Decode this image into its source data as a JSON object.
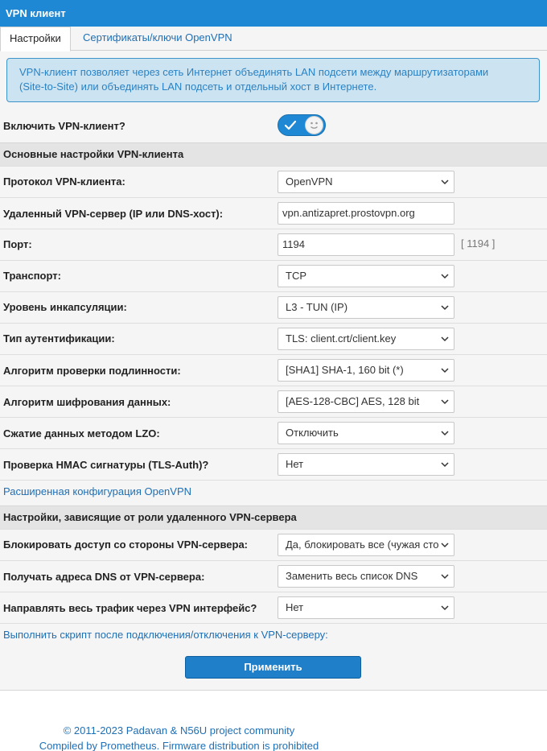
{
  "window": {
    "title": "VPN клиент"
  },
  "tabs": [
    {
      "label": "Настройки",
      "active": true
    },
    {
      "label": "Сертификаты/ключи OpenVPN",
      "active": false
    }
  ],
  "info": {
    "line1": "VPN-клиент позволяет через сеть Интернет объединять LAN подсети между маршрутизаторами",
    "line2": "(Site-to-Site) или объединять LAN подсеть и отдельный хост в Интернете."
  },
  "enable": {
    "label": "Включить VPN-клиент?",
    "on": true
  },
  "sections": {
    "basic": "Основные настройки VPN-клиента",
    "role": "Настройки, зависящие от роли удаленного VPN-сервера"
  },
  "fields": {
    "protocol": {
      "label": "Протокол VPN-клиента:",
      "value": "OpenVPN"
    },
    "server": {
      "label": "Удаленный VPN-сервер (IP или DNS-хост):",
      "value": "vpn.antizapret.prostovpn.org"
    },
    "port": {
      "label": "Порт:",
      "value": "1194",
      "hint": "[ 1194 ]"
    },
    "transport": {
      "label": "Транспорт:",
      "value": "TCP"
    },
    "encap": {
      "label": "Уровень инкапсуляции:",
      "value": "L3 - TUN (IP)"
    },
    "auth": {
      "label": "Тип аутентификации:",
      "value": "TLS: client.crt/client.key"
    },
    "digest": {
      "label": "Алгоритм проверки подлинности:",
      "value": "[SHA1] SHA-1, 160 bit (*)"
    },
    "cipher": {
      "label": "Алгоритм шифрования данных:",
      "value": "[AES-128-CBC] AES, 128 bit"
    },
    "lzo": {
      "label": "Сжатие данных методом LZO:",
      "value": "Отключить"
    },
    "hmac": {
      "label": "Проверка HMAC сигнатуры (TLS-Auth)?",
      "value": "Нет"
    },
    "block": {
      "label": "Блокировать доступ со стороны VPN-сервера:",
      "value": "Да, блокировать все (чужая сто"
    },
    "dns": {
      "label": "Получать адреса DNS от VPN-сервера:",
      "value": "Заменить весь список DNS"
    },
    "redirect": {
      "label": "Направлять весь трафик через VPN интерфейс?",
      "value": "Нет"
    }
  },
  "links": {
    "advanced": "Расширенная конфигурация OpenVPN",
    "script": "Выполнить скрипт после подключения/отключения к VPN-серверу:"
  },
  "apply_label": "Применить",
  "footer": {
    "line1": "© 2011-2023 Padavan & N56U project community",
    "line2": "Compiled by Prometheus. Firmware distribution is prohibited"
  },
  "colors": {
    "accent": "#1f88d4",
    "link": "#1f6fb5",
    "info_bg": "#cce4f2"
  },
  "icons": {
    "toggle_on": "check-icon",
    "select": "chevron-down-icon"
  }
}
